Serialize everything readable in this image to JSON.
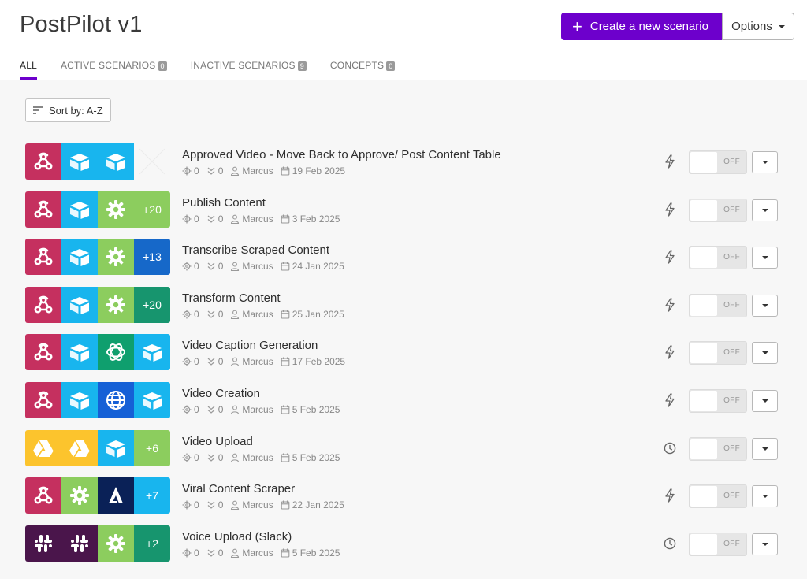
{
  "header": {
    "title": "PostPilot v1",
    "create_label": "Create a new scenario",
    "options_label": "Options"
  },
  "tabs": [
    {
      "label": "ALL",
      "count": null,
      "active": true
    },
    {
      "label": "ACTIVE SCENARIOS",
      "count": "0"
    },
    {
      "label": "INACTIVE SCENARIOS",
      "count": "9"
    },
    {
      "label": "CONCEPTS",
      "count": "0"
    }
  ],
  "sort": {
    "label": "Sort by: A-Z"
  },
  "colors": {
    "accent": "#6d00cc",
    "webhook": "#c5305f",
    "airtable": "#18b5ee",
    "tools": "#8ccd5e",
    "openai": "#0f9f6e",
    "http": "#1560d6",
    "drive": "#fcc42d",
    "adobe": "#0a2157",
    "slack": "#4a154b",
    "plus_green": "#8ccd5e",
    "plus_blue": "#1668c9",
    "plus_teal": "#17956e",
    "plus_sky": "#18b5ee"
  },
  "scenarios": [
    {
      "name": "Approved Video - Move Back to Approve/ Post Content Table",
      "ops": "0",
      "transfers": "0",
      "author": "Marcus",
      "date": "19 Feb 2025",
      "trigger": "instant-icon",
      "status": "OFF",
      "icons": [
        {
          "type": "webhook-icon",
          "color": "#c5305f"
        },
        {
          "type": "airtable-icon",
          "color": "#18b5ee"
        },
        {
          "type": "airtable-icon",
          "color": "#18b5ee"
        },
        {
          "type": "empty",
          "color": "transparent"
        }
      ]
    },
    {
      "name": "Publish Content",
      "ops": "0",
      "transfers": "0",
      "author": "Marcus",
      "date": "3 Feb 2025",
      "trigger": "instant-icon",
      "status": "OFF",
      "icons": [
        {
          "type": "webhook-icon",
          "color": "#c5305f"
        },
        {
          "type": "airtable-icon",
          "color": "#18b5ee"
        },
        {
          "type": "tools-icon",
          "color": "#8ccd5e"
        },
        {
          "type": "more",
          "label": "+20",
          "color": "#8ccd5e"
        }
      ]
    },
    {
      "name": "Transcribe Scraped Content",
      "ops": "0",
      "transfers": "0",
      "author": "Marcus",
      "date": "24 Jan 2025",
      "trigger": "instant-icon",
      "status": "OFF",
      "icons": [
        {
          "type": "webhook-icon",
          "color": "#c5305f"
        },
        {
          "type": "airtable-icon",
          "color": "#18b5ee"
        },
        {
          "type": "tools-icon",
          "color": "#8ccd5e"
        },
        {
          "type": "more",
          "label": "+13",
          "color": "#1668c9"
        }
      ]
    },
    {
      "name": "Transform Content",
      "ops": "0",
      "transfers": "0",
      "author": "Marcus",
      "date": "25 Jan 2025",
      "trigger": "instant-icon",
      "status": "OFF",
      "icons": [
        {
          "type": "webhook-icon",
          "color": "#c5305f"
        },
        {
          "type": "airtable-icon",
          "color": "#18b5ee"
        },
        {
          "type": "tools-icon",
          "color": "#8ccd5e"
        },
        {
          "type": "more",
          "label": "+20",
          "color": "#17956e"
        }
      ]
    },
    {
      "name": "Video Caption Generation",
      "ops": "0",
      "transfers": "0",
      "author": "Marcus",
      "date": "17 Feb 2025",
      "trigger": "instant-icon",
      "status": "OFF",
      "icons": [
        {
          "type": "webhook-icon",
          "color": "#c5305f"
        },
        {
          "type": "airtable-icon",
          "color": "#18b5ee"
        },
        {
          "type": "openai-icon",
          "color": "#0f9f6e"
        },
        {
          "type": "airtable-icon",
          "color": "#18b5ee"
        }
      ]
    },
    {
      "name": "Video Creation",
      "ops": "0",
      "transfers": "0",
      "author": "Marcus",
      "date": "5 Feb 2025",
      "trigger": "instant-icon",
      "status": "OFF",
      "icons": [
        {
          "type": "webhook-icon",
          "color": "#c5305f"
        },
        {
          "type": "airtable-icon",
          "color": "#18b5ee"
        },
        {
          "type": "globe-icon",
          "color": "#1560d6"
        },
        {
          "type": "airtable-icon",
          "color": "#18b5ee"
        }
      ]
    },
    {
      "name": "Video Upload",
      "ops": "0",
      "transfers": "0",
      "author": "Marcus",
      "date": "5 Feb 2025",
      "trigger": "clock-icon",
      "status": "OFF",
      "icons": [
        {
          "type": "drive-icon",
          "color": "#fcc42d"
        },
        {
          "type": "drive-icon",
          "color": "#fcc42d"
        },
        {
          "type": "airtable-icon",
          "color": "#18b5ee"
        },
        {
          "type": "more",
          "label": "+6",
          "color": "#8ccd5e"
        }
      ]
    },
    {
      "name": "Viral Content Scraper",
      "ops": "0",
      "transfers": "0",
      "author": "Marcus",
      "date": "22 Jan 2025",
      "trigger": "instant-icon",
      "status": "OFF",
      "icons": [
        {
          "type": "webhook-icon",
          "color": "#c5305f"
        },
        {
          "type": "tools-icon",
          "color": "#8ccd5e"
        },
        {
          "type": "adobe-icon",
          "color": "#0a2157"
        },
        {
          "type": "more",
          "label": "+7",
          "color": "#18b5ee"
        }
      ]
    },
    {
      "name": "Voice Upload (Slack)",
      "ops": "0",
      "transfers": "0",
      "author": "Marcus",
      "date": "5 Feb 2025",
      "trigger": "clock-icon",
      "status": "OFF",
      "icons": [
        {
          "type": "slack-icon",
          "color": "#4a154b"
        },
        {
          "type": "slack-icon",
          "color": "#4a154b"
        },
        {
          "type": "tools-icon",
          "color": "#8ccd5e"
        },
        {
          "type": "more",
          "label": "+2",
          "color": "#17956e"
        }
      ]
    }
  ]
}
